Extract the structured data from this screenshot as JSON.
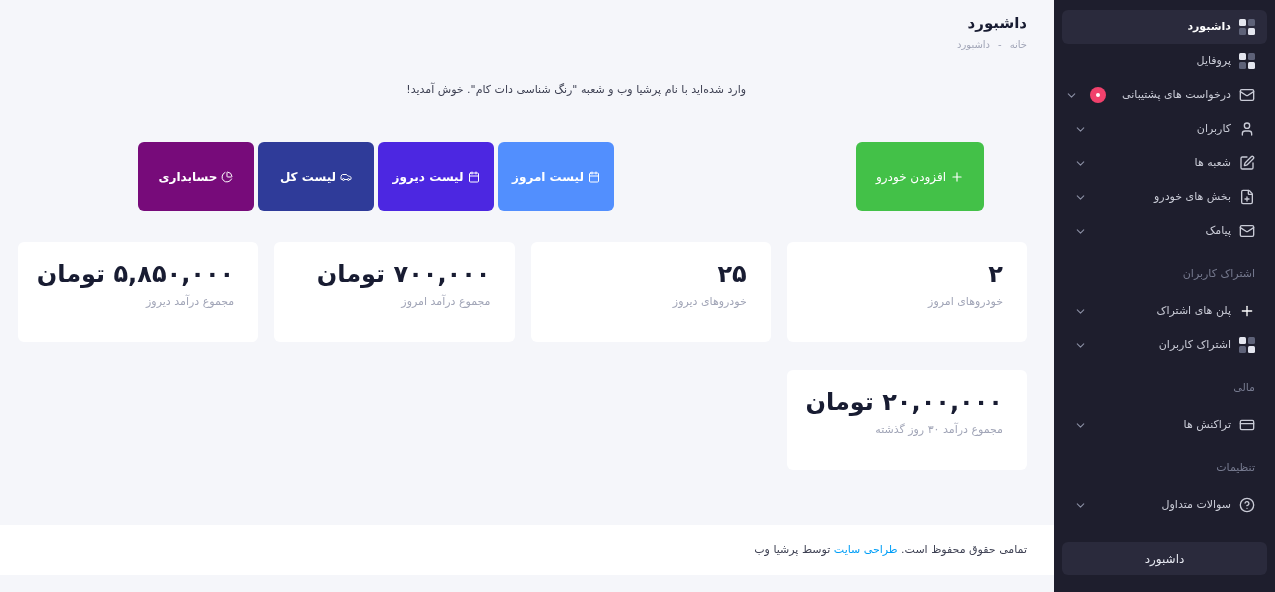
{
  "page": {
    "title": "داشبورد",
    "breadcrumb": [
      "خانه",
      "داشبورد"
    ],
    "breadcrumb_separator": "-",
    "welcome": "وارد شده‌اید با نام پرشیا وب و شعبه \"رنگ شناسی دات کام\". خوش آمدید!"
  },
  "actions": [
    {
      "label": "افزودن خودرو",
      "color": "#43c148"
    },
    {
      "label": "لیست امروز",
      "color": "#528ffe"
    },
    {
      "label": "لیست دیروز",
      "color": "#4c27e1"
    },
    {
      "label": "لیست کل",
      "color": "#2f3b99"
    },
    {
      "label": "حسابداری",
      "color": "#770b7a"
    }
  ],
  "stats": [
    {
      "value": "۲",
      "label": "خودروهای امروز"
    },
    {
      "value": "۲۵",
      "label": "خودروهای دیروز"
    },
    {
      "value": "۷۰۰,۰۰۰ تومان",
      "label": "مجموع درآمد امروز"
    },
    {
      "value": "۵,۸۵۰,۰۰۰ تومان",
      "label": "مجموع درآمد دیروز"
    },
    {
      "value": "۲۰,۰۰,۰۰۰ تومان",
      "label": "مجموع درآمد ۳۰ روز گذشته"
    }
  ],
  "footer": {
    "before": "تمامی حقوق محفوظ است.",
    "link": "طراحی سایت",
    "after": "توسط پرشیا وب"
  },
  "sidebar": {
    "items": [
      {
        "kind": "link",
        "label": "داشبورد",
        "selected": true,
        "expandable": false,
        "badge": false
      },
      {
        "kind": "link",
        "label": "پروفایل",
        "selected": false,
        "expandable": false,
        "badge": false
      },
      {
        "kind": "link",
        "label": "درخواست های پشتیبانی",
        "selected": false,
        "expandable": true,
        "badge": true
      },
      {
        "kind": "link",
        "label": "کاربران",
        "selected": false,
        "expandable": true,
        "badge": false
      },
      {
        "kind": "link",
        "label": "شعبه ها",
        "selected": false,
        "expandable": true,
        "badge": false
      },
      {
        "kind": "link",
        "label": "بخش های خودرو",
        "selected": false,
        "expandable": true,
        "badge": false
      },
      {
        "kind": "link",
        "label": "پیامک",
        "selected": false,
        "expandable": true,
        "badge": false
      },
      {
        "kind": "heading",
        "label": "اشتراک کاربران"
      },
      {
        "kind": "link",
        "label": "پلن های اشتراک",
        "selected": false,
        "expandable": true,
        "badge": false
      },
      {
        "kind": "link",
        "label": "اشتراک کاربران",
        "selected": false,
        "expandable": true,
        "badge": false
      },
      {
        "kind": "heading",
        "label": "مالی"
      },
      {
        "kind": "link",
        "label": "تراکنش ها",
        "selected": false,
        "expandable": true,
        "badge": false
      },
      {
        "kind": "heading",
        "label": "تنظیمات"
      },
      {
        "kind": "link",
        "label": "سوالات متداول",
        "selected": false,
        "expandable": true,
        "badge": false
      }
    ],
    "button": "داشبورد"
  }
}
